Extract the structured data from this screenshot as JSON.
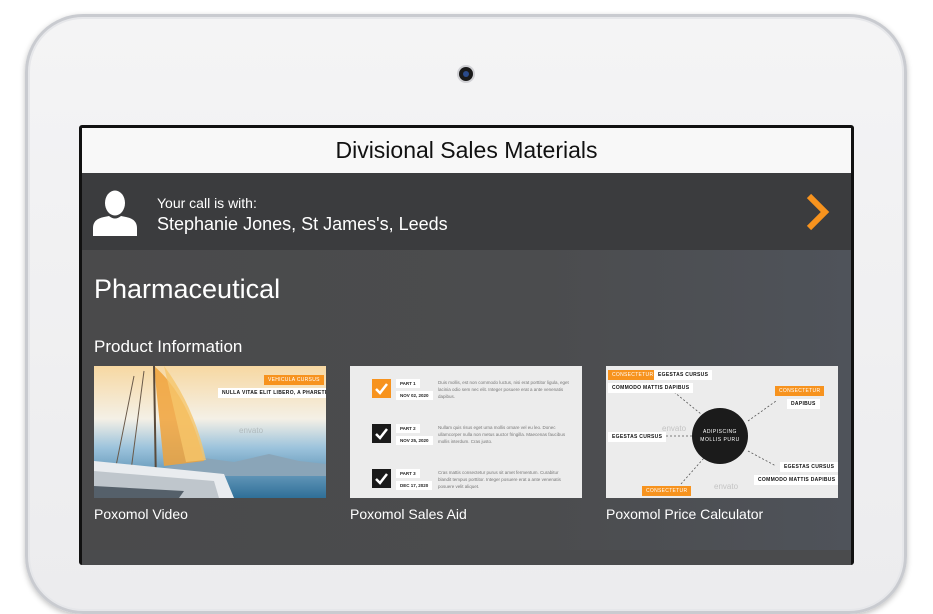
{
  "app": {
    "title": "Divisional Sales Materials"
  },
  "call": {
    "label": "Your call is with:",
    "contact": "Stephanie Jones, St James's, Leeds",
    "avatar_icon": "user-silhouette-icon",
    "next_icon": "chevron-right-icon",
    "accent": "#f7931e"
  },
  "section": {
    "title": "Pharmaceutical",
    "subtitle": "Product Information"
  },
  "cards": [
    {
      "label": "Poxomol Video",
      "tags": [
        "VEHICULA CURSUS",
        "NULLA VITAE ELIT LIBERO, A PHARETRA"
      ]
    },
    {
      "label": "Poxomol Sales Aid",
      "rows": [
        {
          "part": "PART 1",
          "date": "NOV 02, 2020",
          "text": "Duis mollis, est non commodo luctus, nisi erat porttitor ligula, eget lacinia odio sem nec elit. Integer posuere erat a ante venenatis dapibus."
        },
        {
          "part": "PART 2",
          "date": "NOV 25, 2020",
          "text": "Nullam quis risus eget urna mollis ornare vel eu leo. Donec ullamcorper nulla non metus auctor fringilla. Maecenas faucibus mollis interdum. Cras justo."
        },
        {
          "part": "PART 3",
          "date": "DEC 17, 2020",
          "text": "Cras mattis consectetur purus sit amet fermentum. Curabitur blandit tempus porttitor. Integer posuere erat a ante venenatis posuere velit aliquet."
        }
      ]
    },
    {
      "label": "Poxomol Price Calculator",
      "hub": "ADIPISCING MOLLIS PURU",
      "tags": [
        "CONSECTETUR",
        "EGESTAS CURSUS",
        "COMMODO MATTIS DAPIBUS",
        "CONSECTETUR",
        "DAPIBUS",
        "EGESTAS CURSUS",
        "EGESTAS CURSUS",
        "COMMODO MATTIS DAPIBUS",
        "CONSECTETUR"
      ]
    }
  ],
  "watermark": "envato"
}
